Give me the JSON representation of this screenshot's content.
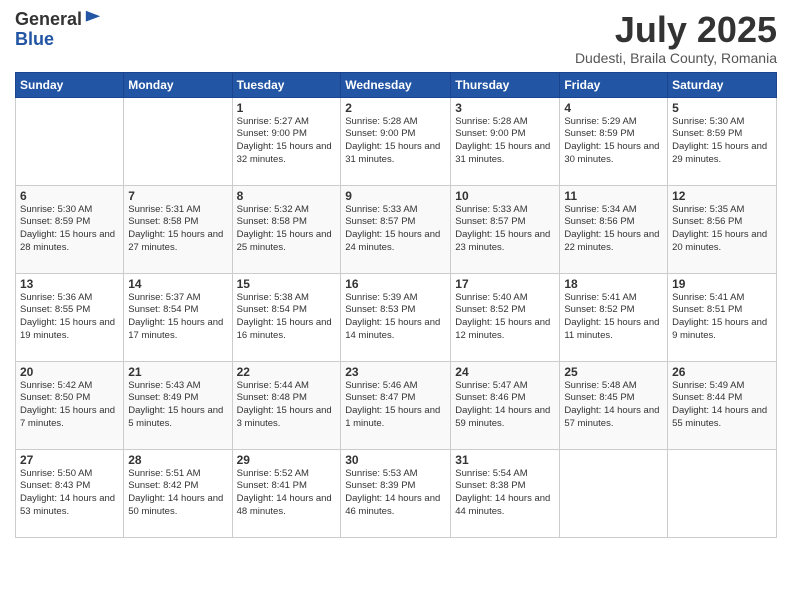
{
  "logo": {
    "general": "General",
    "blue": "Blue"
  },
  "title": {
    "month": "July 2025",
    "location": "Dudesti, Braila County, Romania"
  },
  "weekdays": [
    "Sunday",
    "Monday",
    "Tuesday",
    "Wednesday",
    "Thursday",
    "Friday",
    "Saturday"
  ],
  "weeks": [
    [
      {
        "day": "",
        "info": ""
      },
      {
        "day": "",
        "info": ""
      },
      {
        "day": "1",
        "info": "Sunrise: 5:27 AM\nSunset: 9:00 PM\nDaylight: 15 hours and 32 minutes."
      },
      {
        "day": "2",
        "info": "Sunrise: 5:28 AM\nSunset: 9:00 PM\nDaylight: 15 hours and 31 minutes."
      },
      {
        "day": "3",
        "info": "Sunrise: 5:28 AM\nSunset: 9:00 PM\nDaylight: 15 hours and 31 minutes."
      },
      {
        "day": "4",
        "info": "Sunrise: 5:29 AM\nSunset: 8:59 PM\nDaylight: 15 hours and 30 minutes."
      },
      {
        "day": "5",
        "info": "Sunrise: 5:30 AM\nSunset: 8:59 PM\nDaylight: 15 hours and 29 minutes."
      }
    ],
    [
      {
        "day": "6",
        "info": "Sunrise: 5:30 AM\nSunset: 8:59 PM\nDaylight: 15 hours and 28 minutes."
      },
      {
        "day": "7",
        "info": "Sunrise: 5:31 AM\nSunset: 8:58 PM\nDaylight: 15 hours and 27 minutes."
      },
      {
        "day": "8",
        "info": "Sunrise: 5:32 AM\nSunset: 8:58 PM\nDaylight: 15 hours and 25 minutes."
      },
      {
        "day": "9",
        "info": "Sunrise: 5:33 AM\nSunset: 8:57 PM\nDaylight: 15 hours and 24 minutes."
      },
      {
        "day": "10",
        "info": "Sunrise: 5:33 AM\nSunset: 8:57 PM\nDaylight: 15 hours and 23 minutes."
      },
      {
        "day": "11",
        "info": "Sunrise: 5:34 AM\nSunset: 8:56 PM\nDaylight: 15 hours and 22 minutes."
      },
      {
        "day": "12",
        "info": "Sunrise: 5:35 AM\nSunset: 8:56 PM\nDaylight: 15 hours and 20 minutes."
      }
    ],
    [
      {
        "day": "13",
        "info": "Sunrise: 5:36 AM\nSunset: 8:55 PM\nDaylight: 15 hours and 19 minutes."
      },
      {
        "day": "14",
        "info": "Sunrise: 5:37 AM\nSunset: 8:54 PM\nDaylight: 15 hours and 17 minutes."
      },
      {
        "day": "15",
        "info": "Sunrise: 5:38 AM\nSunset: 8:54 PM\nDaylight: 15 hours and 16 minutes."
      },
      {
        "day": "16",
        "info": "Sunrise: 5:39 AM\nSunset: 8:53 PM\nDaylight: 15 hours and 14 minutes."
      },
      {
        "day": "17",
        "info": "Sunrise: 5:40 AM\nSunset: 8:52 PM\nDaylight: 15 hours and 12 minutes."
      },
      {
        "day": "18",
        "info": "Sunrise: 5:41 AM\nSunset: 8:52 PM\nDaylight: 15 hours and 11 minutes."
      },
      {
        "day": "19",
        "info": "Sunrise: 5:41 AM\nSunset: 8:51 PM\nDaylight: 15 hours and 9 minutes."
      }
    ],
    [
      {
        "day": "20",
        "info": "Sunrise: 5:42 AM\nSunset: 8:50 PM\nDaylight: 15 hours and 7 minutes."
      },
      {
        "day": "21",
        "info": "Sunrise: 5:43 AM\nSunset: 8:49 PM\nDaylight: 15 hours and 5 minutes."
      },
      {
        "day": "22",
        "info": "Sunrise: 5:44 AM\nSunset: 8:48 PM\nDaylight: 15 hours and 3 minutes."
      },
      {
        "day": "23",
        "info": "Sunrise: 5:46 AM\nSunset: 8:47 PM\nDaylight: 15 hours and 1 minute."
      },
      {
        "day": "24",
        "info": "Sunrise: 5:47 AM\nSunset: 8:46 PM\nDaylight: 14 hours and 59 minutes."
      },
      {
        "day": "25",
        "info": "Sunrise: 5:48 AM\nSunset: 8:45 PM\nDaylight: 14 hours and 57 minutes."
      },
      {
        "day": "26",
        "info": "Sunrise: 5:49 AM\nSunset: 8:44 PM\nDaylight: 14 hours and 55 minutes."
      }
    ],
    [
      {
        "day": "27",
        "info": "Sunrise: 5:50 AM\nSunset: 8:43 PM\nDaylight: 14 hours and 53 minutes."
      },
      {
        "day": "28",
        "info": "Sunrise: 5:51 AM\nSunset: 8:42 PM\nDaylight: 14 hours and 50 minutes."
      },
      {
        "day": "29",
        "info": "Sunrise: 5:52 AM\nSunset: 8:41 PM\nDaylight: 14 hours and 48 minutes."
      },
      {
        "day": "30",
        "info": "Sunrise: 5:53 AM\nSunset: 8:39 PM\nDaylight: 14 hours and 46 minutes."
      },
      {
        "day": "31",
        "info": "Sunrise: 5:54 AM\nSunset: 8:38 PM\nDaylight: 14 hours and 44 minutes."
      },
      {
        "day": "",
        "info": ""
      },
      {
        "day": "",
        "info": ""
      }
    ]
  ]
}
